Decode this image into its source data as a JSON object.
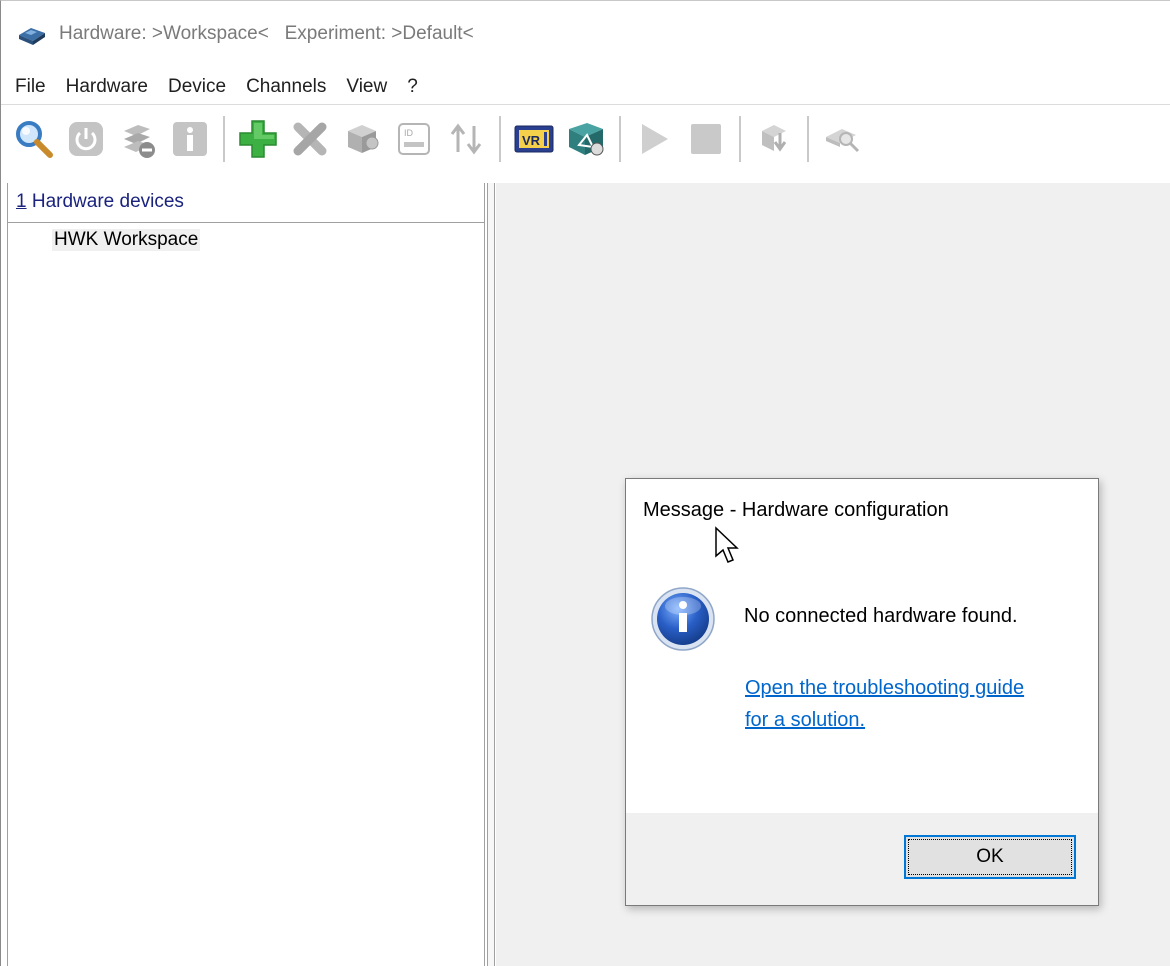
{
  "window": {
    "title": "Hardware: >Workspace<   Experiment: >Default<",
    "icon": "hardware-chip-icon"
  },
  "menu": {
    "items": [
      "File",
      "Hardware",
      "Device",
      "Channels",
      "View",
      "?"
    ]
  },
  "toolbar": {
    "buttons": [
      {
        "name": "search-icon",
        "enabled": true
      },
      {
        "name": "power-icon",
        "enabled": false
      },
      {
        "name": "remove-device-icon",
        "enabled": false
      },
      {
        "name": "info-icon",
        "enabled": false
      },
      {
        "name": "add-icon",
        "enabled": true
      },
      {
        "name": "delete-icon",
        "enabled": false
      },
      {
        "name": "module-icon",
        "enabled": false
      },
      {
        "name": "id-card-icon",
        "enabled": false
      },
      {
        "name": "sort-icon",
        "enabled": false
      },
      {
        "name": "vr-icon",
        "enabled": true
      },
      {
        "name": "sensor-database-icon",
        "enabled": true
      },
      {
        "name": "play-icon",
        "enabled": false
      },
      {
        "name": "stop-icon",
        "enabled": false
      },
      {
        "name": "import-icon",
        "enabled": false
      },
      {
        "name": "scan-icon",
        "enabled": false
      }
    ]
  },
  "tree": {
    "header_accel": "1",
    "header_label": " Hardware devices",
    "items": [
      {
        "label": "HWK Workspace"
      }
    ]
  },
  "dialog": {
    "title": "Message - Hardware configuration",
    "icon": "info-icon",
    "message": "No connected hardware found.",
    "link_text": "Open the troubleshooting guide for a solution.",
    "ok_label": "OK"
  },
  "colors": {
    "link": "#0066cc",
    "tree_header": "#1a237e",
    "ok_border": "#0078d7",
    "add_green": "#3cb043"
  }
}
